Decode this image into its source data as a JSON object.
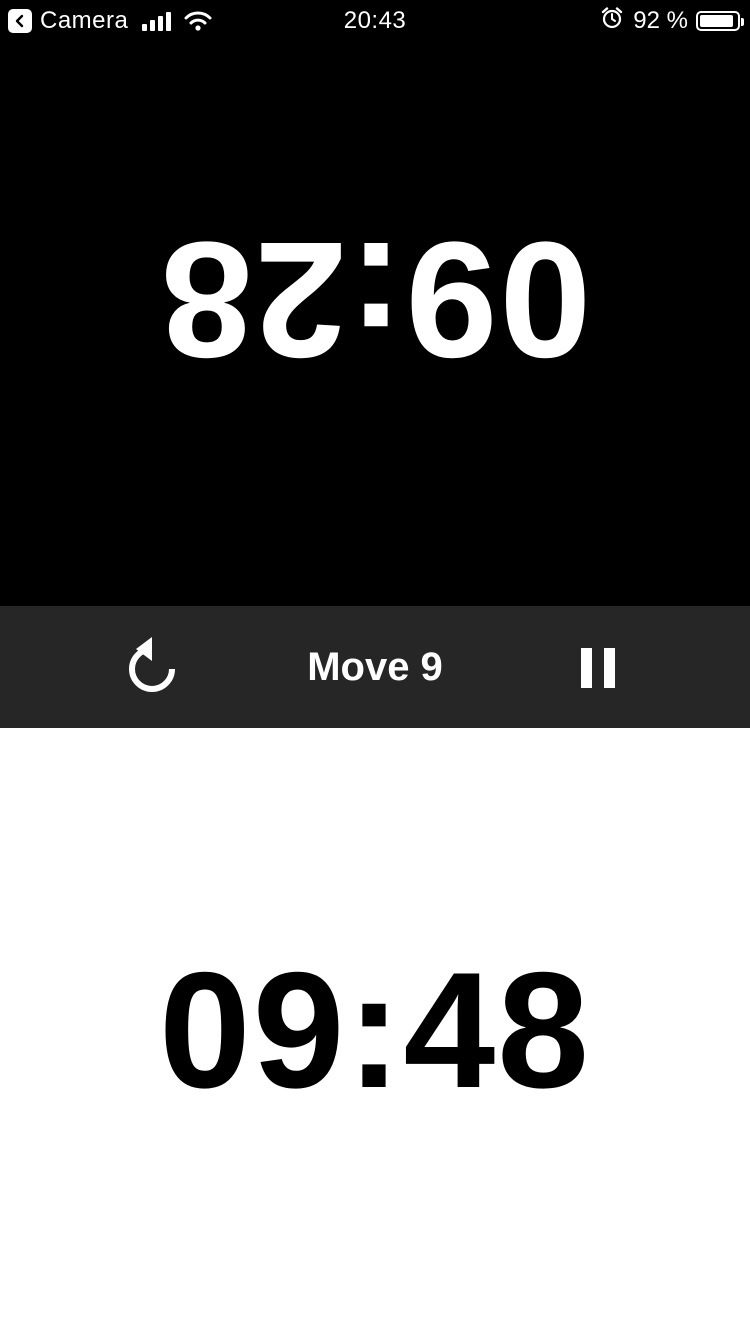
{
  "status_bar": {
    "back_app": "Camera",
    "time": "20:43",
    "battery_percent": "92 %",
    "battery_level": 0.92,
    "icons": [
      "back-arrow-icon",
      "signal-icon",
      "wifi-icon",
      "alarm-icon",
      "battery-icon"
    ]
  },
  "players": {
    "top": {
      "clock": "09:28",
      "background": "#000000",
      "text_color": "#ffffff",
      "orientation": "upside-down"
    },
    "bottom": {
      "clock": "09:48",
      "background": "#ffffff",
      "text_color": "#000000"
    }
  },
  "control_bar": {
    "move_label": "Move 9",
    "background": "#262626",
    "reset_icon": "reset-icon",
    "pause_icon": "pause-icon"
  }
}
